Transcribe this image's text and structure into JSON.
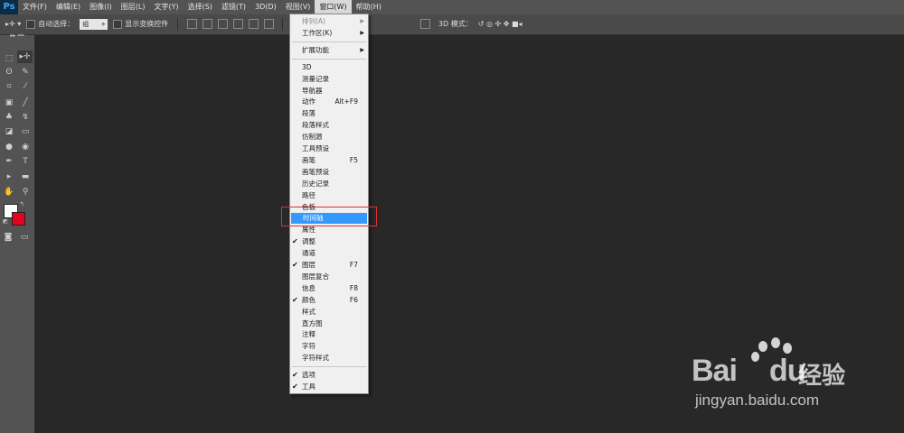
{
  "app": {
    "logo": "Ps"
  },
  "menubar": {
    "items": [
      "文件(F)",
      "编辑(E)",
      "图像(I)",
      "图层(L)",
      "文字(Y)",
      "选择(S)",
      "滤镜(T)",
      "3D(D)",
      "视图(V)",
      "窗口(W)",
      "帮助(H)"
    ],
    "active_index": 9
  },
  "options_bar": {
    "auto_select_label": "自动选择：",
    "auto_select_value": "组",
    "show_transform_label": "显示变换控件",
    "mode_3d_label": "3D 模式："
  },
  "window_menu": {
    "items": [
      {
        "label": "排列(A)",
        "disabled": true,
        "submenu": true
      },
      {
        "label": "工作区(K)",
        "submenu": true
      },
      {
        "separator": true
      },
      {
        "label": "扩展功能",
        "submenu": true
      },
      {
        "separator": true
      },
      {
        "label": "3D"
      },
      {
        "label": "测量记录"
      },
      {
        "label": "导航器"
      },
      {
        "label": "动作",
        "shortcut": "Alt+F9"
      },
      {
        "label": "段落"
      },
      {
        "label": "段落样式"
      },
      {
        "label": "仿制源"
      },
      {
        "label": "工具预设"
      },
      {
        "label": "画笔",
        "shortcut": "F5"
      },
      {
        "label": "画笔预设"
      },
      {
        "label": "历史记录"
      },
      {
        "label": "路径"
      },
      {
        "label": "色板"
      },
      {
        "label": "时间轴",
        "highlighted": true
      },
      {
        "label": "属性"
      },
      {
        "label": "调整",
        "checked": true
      },
      {
        "label": "通道"
      },
      {
        "label": "图层",
        "shortcut": "F7",
        "checked": true
      },
      {
        "label": "图层复合"
      },
      {
        "label": "信息",
        "shortcut": "F8"
      },
      {
        "label": "颜色",
        "shortcut": "F6",
        "checked": true
      },
      {
        "label": "样式"
      },
      {
        "label": "直方图"
      },
      {
        "label": "注释"
      },
      {
        "label": "字符"
      },
      {
        "label": "字符样式"
      },
      {
        "separator": true
      },
      {
        "label": "选项",
        "checked": true
      },
      {
        "label": "工具",
        "checked": true
      }
    ]
  },
  "colors": {
    "foreground": "#ffffff",
    "background": "#e8001c",
    "accent": "#3399ff"
  },
  "watermark": {
    "logo": "Bai",
    "logo2": "du",
    "brand": "经验",
    "url": "jingyan.baidu.com"
  }
}
